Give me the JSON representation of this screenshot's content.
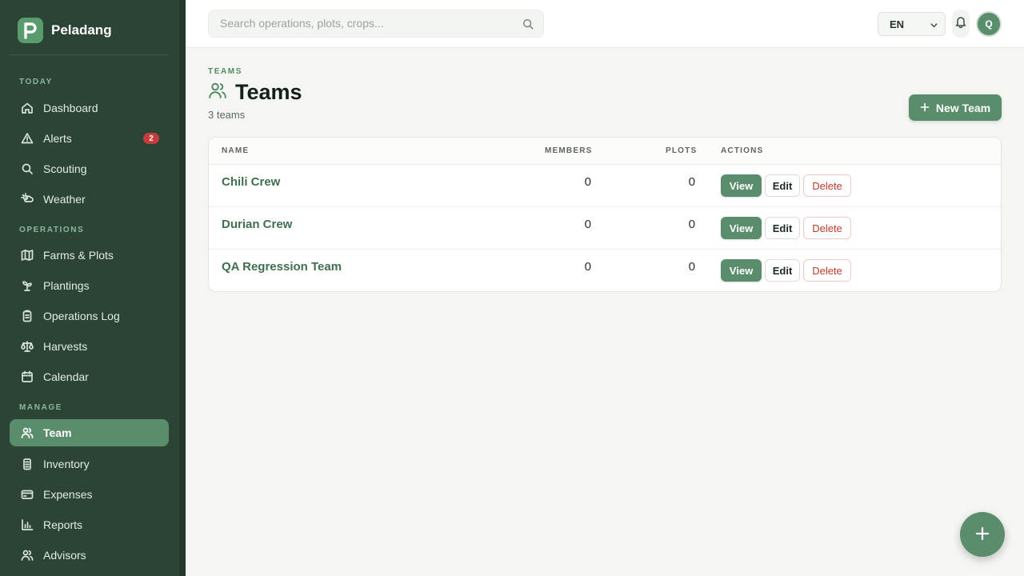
{
  "app": {
    "name": "Peladang",
    "logo_letter": "P"
  },
  "sidebar": {
    "sections": [
      {
        "label": "TODAY"
      },
      {
        "label": "OPERATIONS"
      },
      {
        "label": "MANAGE"
      }
    ],
    "items": [
      {
        "label": "Dashboard",
        "icon": "home-icon"
      },
      {
        "label": "Alerts",
        "icon": "alert-triangle-icon",
        "badge": "2"
      },
      {
        "label": "Scouting",
        "icon": "search-icon"
      },
      {
        "label": "Weather",
        "icon": "weather-icon"
      },
      {
        "label": "Farms & Plots",
        "icon": "map-icon"
      },
      {
        "label": "Plantings",
        "icon": "sprout-icon"
      },
      {
        "label": "Operations Log",
        "icon": "clipboard-icon"
      },
      {
        "label": "Harvests",
        "icon": "scale-icon"
      },
      {
        "label": "Calendar",
        "icon": "calendar-icon"
      },
      {
        "label": "Team",
        "icon": "users-icon",
        "active": true
      },
      {
        "label": "Inventory",
        "icon": "box-icon"
      },
      {
        "label": "Expenses",
        "icon": "credit-card-icon"
      },
      {
        "label": "Reports",
        "icon": "bar-chart-icon"
      },
      {
        "label": "Advisors",
        "icon": "advisors-icon"
      }
    ]
  },
  "topbar": {
    "search_placeholder": "Search operations, plots, crops...",
    "language": "EN",
    "avatar_initial": "Q"
  },
  "page": {
    "eyebrow": "TEAMS",
    "title": "Teams",
    "subtitle": "3 teams",
    "new_button": "New Team"
  },
  "table": {
    "columns": {
      "name": "NAME",
      "members": "MEMBERS",
      "plots": "PLOTS",
      "actions": "ACTIONS"
    },
    "rows": [
      {
        "name": "Chili Crew",
        "members": "0",
        "plots": "0"
      },
      {
        "name": "Durian Crew",
        "members": "0",
        "plots": "0"
      },
      {
        "name": "QA Regression Team",
        "members": "0",
        "plots": "0"
      }
    ],
    "actions": {
      "view": "View",
      "edit": "Edit",
      "delete": "Delete"
    }
  },
  "colors": {
    "sidebar_bg": "#2b4435",
    "accent": "#5a8d6b",
    "danger": "#c0392b",
    "badge": "#c63b3b"
  }
}
